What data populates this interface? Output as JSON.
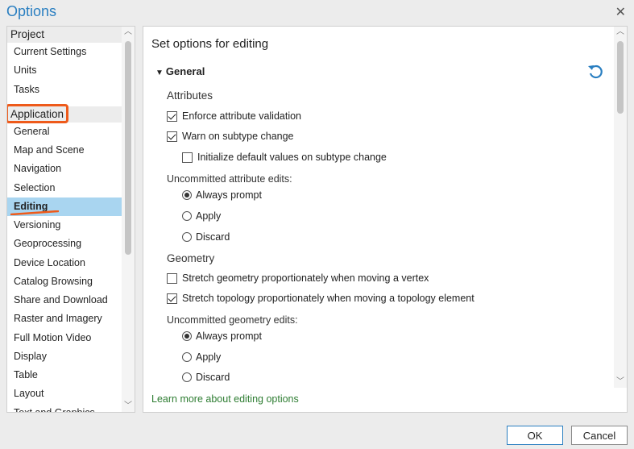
{
  "window": {
    "title": "Options",
    "close_glyph": "✕"
  },
  "sidebar": {
    "project_header": "Project",
    "project_items": [
      "Current Settings",
      "Units",
      "Tasks"
    ],
    "application_header": "Application",
    "application_items": [
      "General",
      "Map and Scene",
      "Navigation",
      "Selection",
      "Editing",
      "Versioning",
      "Geoprocessing",
      "Device Location",
      "Catalog Browsing",
      "Share and Download",
      "Raster and Imagery",
      "Full Motion Video",
      "Display",
      "Table",
      "Layout",
      "Text and Graphics"
    ],
    "selected": "Editing"
  },
  "panel": {
    "title": "Set options for editing",
    "section_header": "General",
    "attributes": {
      "header": "Attributes",
      "enforce_validation": {
        "label": "Enforce attribute validation",
        "checked": true
      },
      "warn_subtype": {
        "label": "Warn on subtype change",
        "checked": true
      },
      "init_defaults": {
        "label": "Initialize default values on subtype change",
        "checked": false
      },
      "uncommitted_label": "Uncommitted attribute edits:",
      "options": [
        "Always prompt",
        "Apply",
        "Discard"
      ],
      "selected": "Always prompt"
    },
    "geometry": {
      "header": "Geometry",
      "stretch_geometry": {
        "label": "Stretch geometry proportionately when moving a vertex",
        "checked": false
      },
      "stretch_topology": {
        "label": "Stretch topology proportionately when moving a topology element",
        "checked": true
      },
      "uncommitted_label": "Uncommitted geometry edits:",
      "options": [
        "Always prompt",
        "Apply",
        "Discard"
      ],
      "selected": "Always prompt"
    },
    "learn_more": "Learn more about editing options"
  },
  "buttons": {
    "ok": "OK",
    "cancel": "Cancel"
  },
  "icons": {
    "reset": "reset-icon",
    "expand": "chevron-down-icon"
  },
  "colors": {
    "accent": "#2a7fc1",
    "selection": "#a9d5f0",
    "annotation": "#ee5a1a",
    "link": "#2e7d32"
  }
}
